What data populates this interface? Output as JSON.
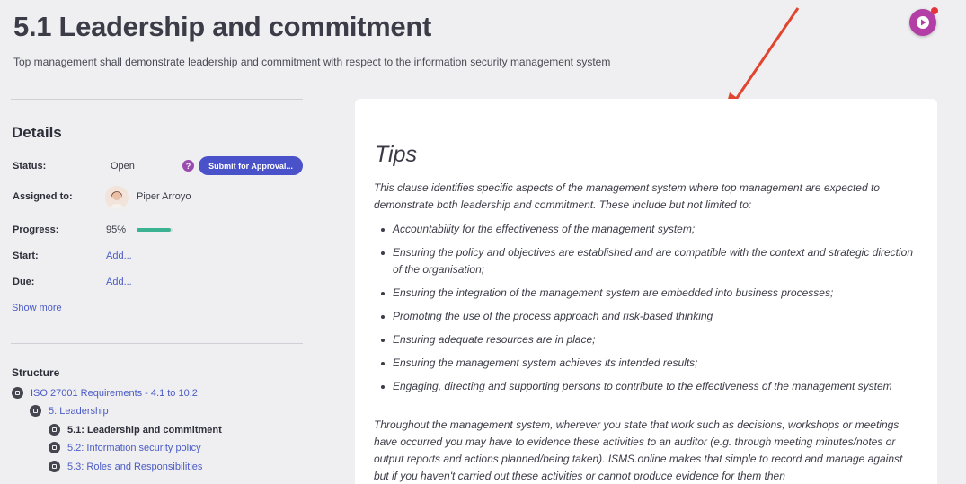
{
  "header": {
    "title": "5.1 Leadership and commitment",
    "subtitle": "Top management shall demonstrate leadership and commitment with respect to the information security management system"
  },
  "details": {
    "title": "Details",
    "status_label": "Status:",
    "status_value": "Open",
    "help_icon": "?",
    "submit_button": "Submit for Approval...",
    "assigned_label": "Assigned to:",
    "assignee": "Piper Arroyo",
    "progress_label": "Progress:",
    "progress_value": "95%",
    "progress_fraction": 0.95,
    "start_label": "Start:",
    "start_value": "Add...",
    "due_label": "Due:",
    "due_value": "Add...",
    "show_more": "Show more"
  },
  "structure": {
    "title": "Structure",
    "items": [
      {
        "label": "ISO 27001 Requirements - 4.1 to 10.2",
        "icon": "book-icon"
      },
      {
        "label": "5: Leadership",
        "icon": "book-icon"
      },
      {
        "label": "5.1: Leadership and commitment",
        "icon": "page-icon"
      },
      {
        "label": "5.2: Information security policy",
        "icon": "page-icon"
      },
      {
        "label": "5.3: Roles and Responsibilities",
        "icon": "page-icon"
      }
    ]
  },
  "tips": {
    "heading": "Tips",
    "intro": "This clause identifies specific aspects of the management system where top management are expected to demonstrate both leadership and commitment. These include but not limited to:",
    "bullets": [
      "Accountability for the effectiveness of the management system;",
      "Ensuring the policy and objectives are established and are compatible with the context and strategic direction of the organisation;",
      "Ensuring the integration of the management system are embedded into business processes;",
      "Promoting the use of the process approach and risk-based thinking",
      "Ensuring adequate resources are in place;",
      "Ensuring the management system achieves its intended results;",
      "Engaging, directing and supporting persons to contribute to the effectiveness of the management system"
    ],
    "outro": "Throughout the management system, wherever you state that work such as decisions, workshops or meetings have occurred you may have to evidence these activities to an auditor (e.g. through meeting minutes/notes or output reports and actions planned/being taken). ISMS.online makes that simple to record and manage against but if you haven't carried out these activities or cannot produce evidence for them then"
  },
  "colors": {
    "accent": "#4a52c9",
    "progress": "#3bb393",
    "fab": "#b23ea6",
    "arrow": "#e0452f"
  }
}
